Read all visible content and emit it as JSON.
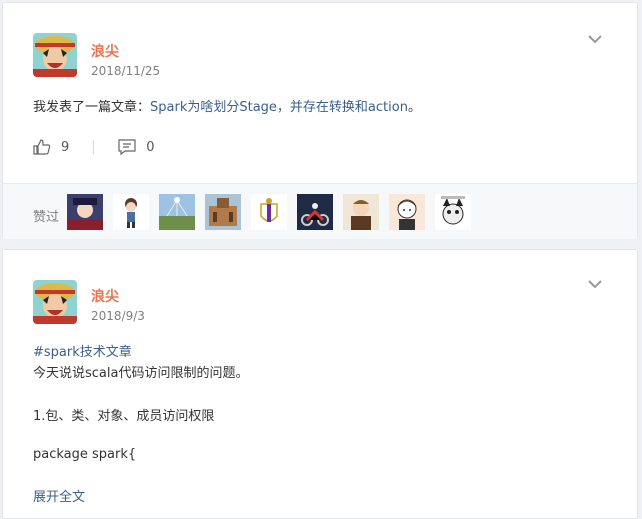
{
  "post1": {
    "author": "浪尖",
    "date": "2018/11/25",
    "text_prefix": "我发表了一篇文章：",
    "article_link": "Spark为啥划分Stage，并存在转换和action",
    "text_suffix": "。",
    "likes_count": "9",
    "comments_count": "0",
    "likes_label": "赞过",
    "likers": [
      "liker-1",
      "liker-2",
      "liker-3",
      "liker-4",
      "liker-5",
      "liker-6",
      "liker-7",
      "liker-8",
      "liker-9"
    ]
  },
  "post2": {
    "author": "浪尖",
    "date": "2018/9/3",
    "hashtag": "#spark技术文章",
    "line1": "今天说说scala代码访问限制的问题。",
    "line2": "1.包、类、对象、成员访问权限",
    "line3": "package spark{",
    "expand": "展开全文"
  },
  "colors": {
    "author": "#eb7350",
    "link": "#3a5f8a",
    "date": "#808080"
  }
}
